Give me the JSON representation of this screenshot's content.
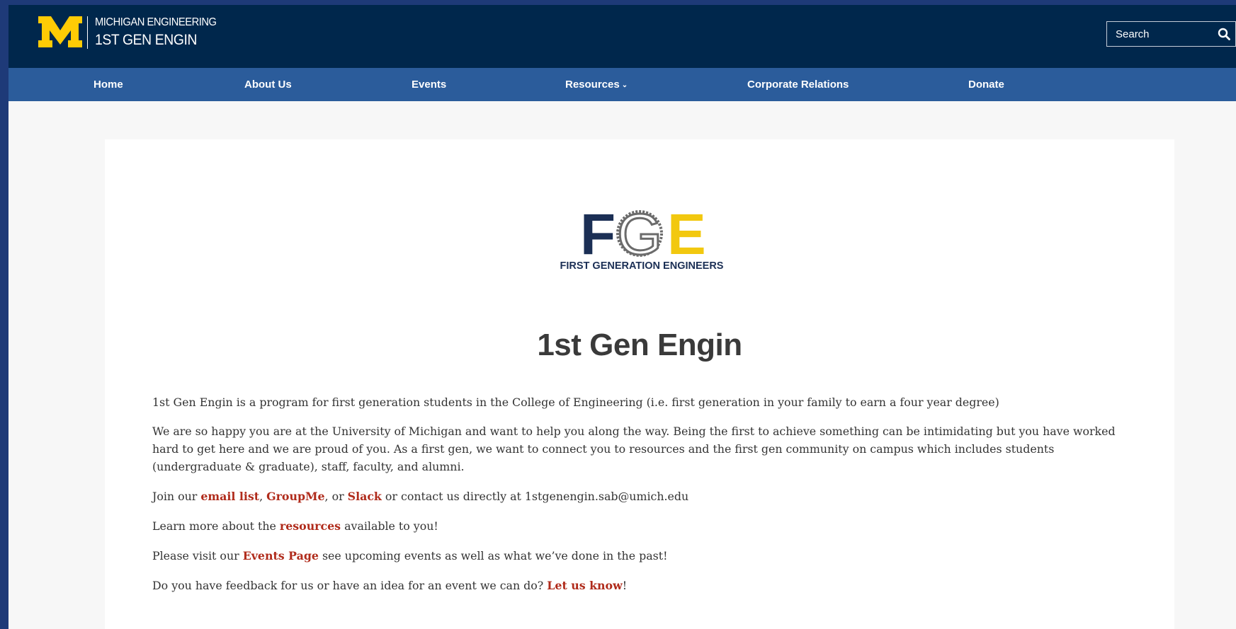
{
  "header": {
    "university": "MICHIGAN ENGINEERING",
    "site_name": "1ST GEN ENGIN",
    "search_placeholder": "Search",
    "colors": {
      "maize": "#ffcb05",
      "blue": "#00274c",
      "nav": "#2b5c9b",
      "link": "#b02b1b"
    }
  },
  "nav": {
    "items": [
      {
        "label": "Home"
      },
      {
        "label": "About Us"
      },
      {
        "label": "Events"
      },
      {
        "label": "Resources",
        "has_dropdown": true,
        "icon": "chevron-down-icon"
      },
      {
        "label": "Corporate Relations"
      },
      {
        "label": "Donate"
      }
    ]
  },
  "logo": {
    "letters": [
      "F",
      "G",
      "E"
    ],
    "caption": "FIRST GENERATION ENGINEERS"
  },
  "main": {
    "title": "1st Gen Engin",
    "intro": "1st Gen Engin is a program for first generation students in the College of Engineering (i.e. first generation in your family to earn a four year degree)",
    "welcome": "We are so happy you are at the University of Michigan and want to help you along the way. Being the first to achieve something can be intimidating but you have worked hard to get here and we are proud of you. As a first gen, we want to connect you to resources and the first gen community on campus which includes students (undergraduate & graduate), staff, faculty, and alumni.",
    "join": {
      "prefix": "Join our ",
      "email_link": "email list",
      "sep1": ", ",
      "groupme_link": "GroupMe",
      "sep2": ", or ",
      "slack_link": "Slack",
      "suffix": " or contact us directly at 1stgenengin.sab@umich.edu"
    },
    "learn": {
      "prefix": "Learn more about the ",
      "link": "resources",
      "suffix": " available to you!"
    },
    "events": {
      "prefix": "Please visit our ",
      "link": "Events Page",
      "suffix": " see upcoming events as well as what we’ve done in the past!"
    },
    "feedback": {
      "prefix": "Do you have feedback for us or have an idea for an event we can do? ",
      "link": "Let us know",
      "suffix": "!"
    }
  }
}
